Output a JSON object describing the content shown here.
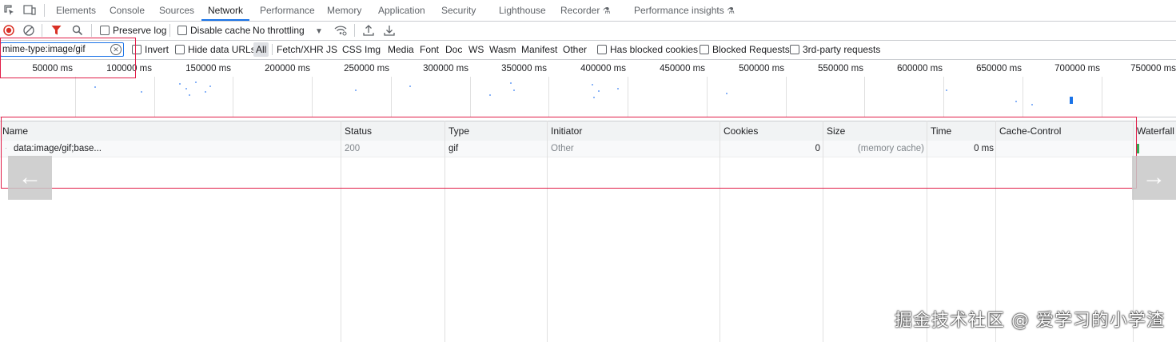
{
  "tabs": [
    "Elements",
    "Console",
    "Sources",
    "Network",
    "Performance",
    "Memory",
    "Application",
    "Security",
    "Lighthouse",
    "Recorder",
    "Performance insights"
  ],
  "active_tab": "Network",
  "toolbar": {
    "preserve_log": "Preserve log",
    "disable_cache": "Disable cache",
    "throttling": "No throttling"
  },
  "filter": {
    "value": "mime-type:image/gif",
    "invert": "Invert",
    "hide_data_urls": "Hide data URLs",
    "types": [
      "All",
      "Fetch/XHR",
      "JS",
      "CSS",
      "Img",
      "Media",
      "Font",
      "Doc",
      "WS",
      "Wasm",
      "Manifest",
      "Other"
    ],
    "has_blocked_cookies": "Has blocked cookies",
    "blocked_requests": "Blocked Requests",
    "third_party": "3rd-party requests"
  },
  "overview": {
    "ticks": [
      "50000 ms",
      "100000 ms",
      "150000 ms",
      "200000 ms",
      "250000 ms",
      "300000 ms",
      "350000 ms",
      "400000 ms",
      "450000 ms",
      "500000 ms",
      "550000 ms",
      "600000 ms",
      "650000 ms",
      "700000 ms",
      "750000 ms"
    ]
  },
  "table": {
    "columns": [
      "Name",
      "Status",
      "Type",
      "Initiator",
      "Cookies",
      "Size",
      "Time",
      "Cache-Control",
      "Waterfall"
    ],
    "rows": [
      {
        "name": "data:image/gif;base...",
        "status": "200",
        "type": "gif",
        "initiator": "Other",
        "cookies": "0",
        "size": "(memory cache)",
        "time": "0 ms",
        "cache_control": ""
      }
    ]
  },
  "nav": {
    "prev": "←",
    "next": "→"
  },
  "watermark": "掘金技术社区 @ 爱学习的小学渣",
  "colors": {
    "accent": "#1a73e8",
    "record": "#d93025",
    "filter_active": "#d93025",
    "highlight_box": "#e11d48"
  }
}
